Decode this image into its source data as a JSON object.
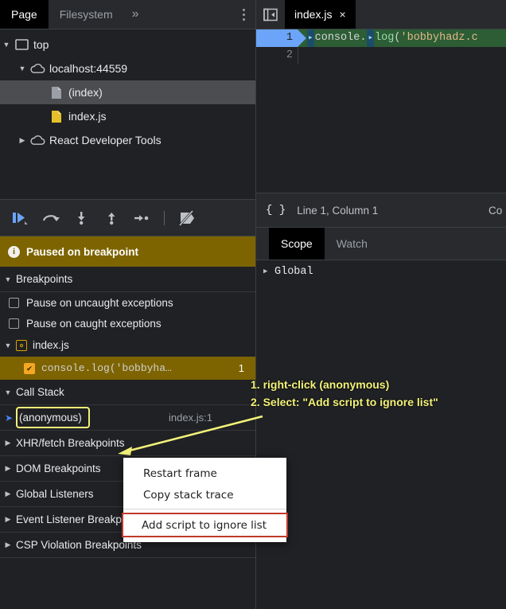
{
  "navigator": {
    "tabs": [
      {
        "label": "Page",
        "active": true
      },
      {
        "label": "Filesystem",
        "active": false
      }
    ],
    "more_label": "»",
    "menu_icon": "kebab-menu-icon",
    "tree": [
      {
        "arrow": "▼",
        "icon": "frame-icon",
        "label": "top",
        "indent": 0,
        "selected": false
      },
      {
        "arrow": "▼",
        "icon": "cloud-icon",
        "label": "localhost:44559",
        "indent": 20,
        "selected": false
      },
      {
        "arrow": "",
        "icon": "document-icon",
        "label": "(index)",
        "indent": 44,
        "selected": true
      },
      {
        "arrow": "",
        "icon": "js-file-icon",
        "label": "index.js",
        "indent": 44,
        "selected": false
      },
      {
        "arrow": "▶",
        "icon": "cloud-icon",
        "label": "React Developer Tools",
        "indent": 20,
        "selected": false
      }
    ]
  },
  "debug_toolbar": {
    "buttons": [
      {
        "name": "resume-button",
        "title": "Resume script execution"
      },
      {
        "name": "step-over-button",
        "title": "Step over next function call"
      },
      {
        "name": "step-into-button",
        "title": "Step into next function call"
      },
      {
        "name": "step-out-button",
        "title": "Step out of current function"
      },
      {
        "name": "step-button",
        "title": "Step"
      },
      {
        "name": "deactivate-breakpoints-button",
        "title": "Deactivate breakpoints"
      }
    ]
  },
  "paused_banner": {
    "icon": "info-icon",
    "text": "Paused on breakpoint"
  },
  "breakpoints_pane": {
    "title": "Breakpoints",
    "arrow": "▼",
    "checkboxes": [
      {
        "label": "Pause on uncaught exceptions",
        "checked": false
      },
      {
        "label": "Pause on caught exceptions",
        "checked": false
      }
    ],
    "file": {
      "arrow": "▼",
      "icon": "breakpoint-file-icon",
      "name": "index.js"
    },
    "items": [
      {
        "snippet": "console.log('bobbyha…",
        "line": "1",
        "checked": true,
        "check_glyph": "✔"
      }
    ]
  },
  "call_stack_pane": {
    "title": "Call Stack",
    "arrow": "▼",
    "frames": [
      {
        "marker": "➤",
        "name": "(anonymous)",
        "location": "index.js:1",
        "selected": true
      }
    ]
  },
  "other_panes": [
    {
      "arrow": "▶",
      "title": "XHR/fetch Breakpoints"
    },
    {
      "arrow": "▶",
      "title": "DOM Breakpoints"
    },
    {
      "arrow": "▶",
      "title": "Global Listeners"
    },
    {
      "arrow": "▶",
      "title": "Event Listener Breakpoints"
    },
    {
      "arrow": "▶",
      "title": "CSP Violation Breakpoints"
    }
  ],
  "source_panel": {
    "toggle_icon": "show-navigator-icon",
    "tab": {
      "label": "index.js",
      "close_glyph": "×"
    },
    "code": {
      "lines": [
        {
          "number": "1",
          "executing": true,
          "tokens": [
            {
              "text": "console",
              "type": "plain"
            },
            {
              "text": ".",
              "type": "punct"
            },
            {
              "text": "log",
              "type": "fn"
            },
            {
              "text": "(",
              "type": "punct"
            },
            {
              "text": "'bobbyhadz.c",
              "type": "str"
            }
          ],
          "plain_text": "console.log('bobbyhadz.c"
        },
        {
          "number": "2",
          "executing": false,
          "tokens": [],
          "plain_text": ""
        }
      ]
    }
  },
  "status_bar": {
    "braces_icon": "pretty-print-icon",
    "position": "Line 1, Column 1",
    "right_truncated": "Co"
  },
  "scope_panel": {
    "tabs": [
      {
        "label": "Scope",
        "active": true
      },
      {
        "label": "Watch",
        "active": false
      }
    ],
    "rows": [
      {
        "arrow": "▶",
        "label": "Global"
      }
    ]
  },
  "annotation": {
    "line1": "1. right-click (anonymous)",
    "line2": "2. Select: \"Add script to ignore list\"",
    "arrow_color": "#f2f279",
    "text_color": "#f2f279"
  },
  "context_menu": {
    "items": [
      {
        "label": "Restart frame",
        "highlighted": false,
        "separator_after": false
      },
      {
        "label": "Copy stack trace",
        "highlighted": false,
        "separator_after": true
      },
      {
        "label": "Add script to ignore list",
        "highlighted": true,
        "separator_after": false
      }
    ],
    "highlight_color": "#c0392b"
  },
  "colors": {
    "background": "#202124",
    "panel": "#292a2d",
    "paused_banner": "#7d6400",
    "accent_blue": "#4285f4",
    "breakpoint_orange": "#f5a623",
    "annotation_yellow": "#f2f279",
    "exec_line_green": "#2c5d35",
    "exec_gutter_blue": "#6ba4f8"
  }
}
